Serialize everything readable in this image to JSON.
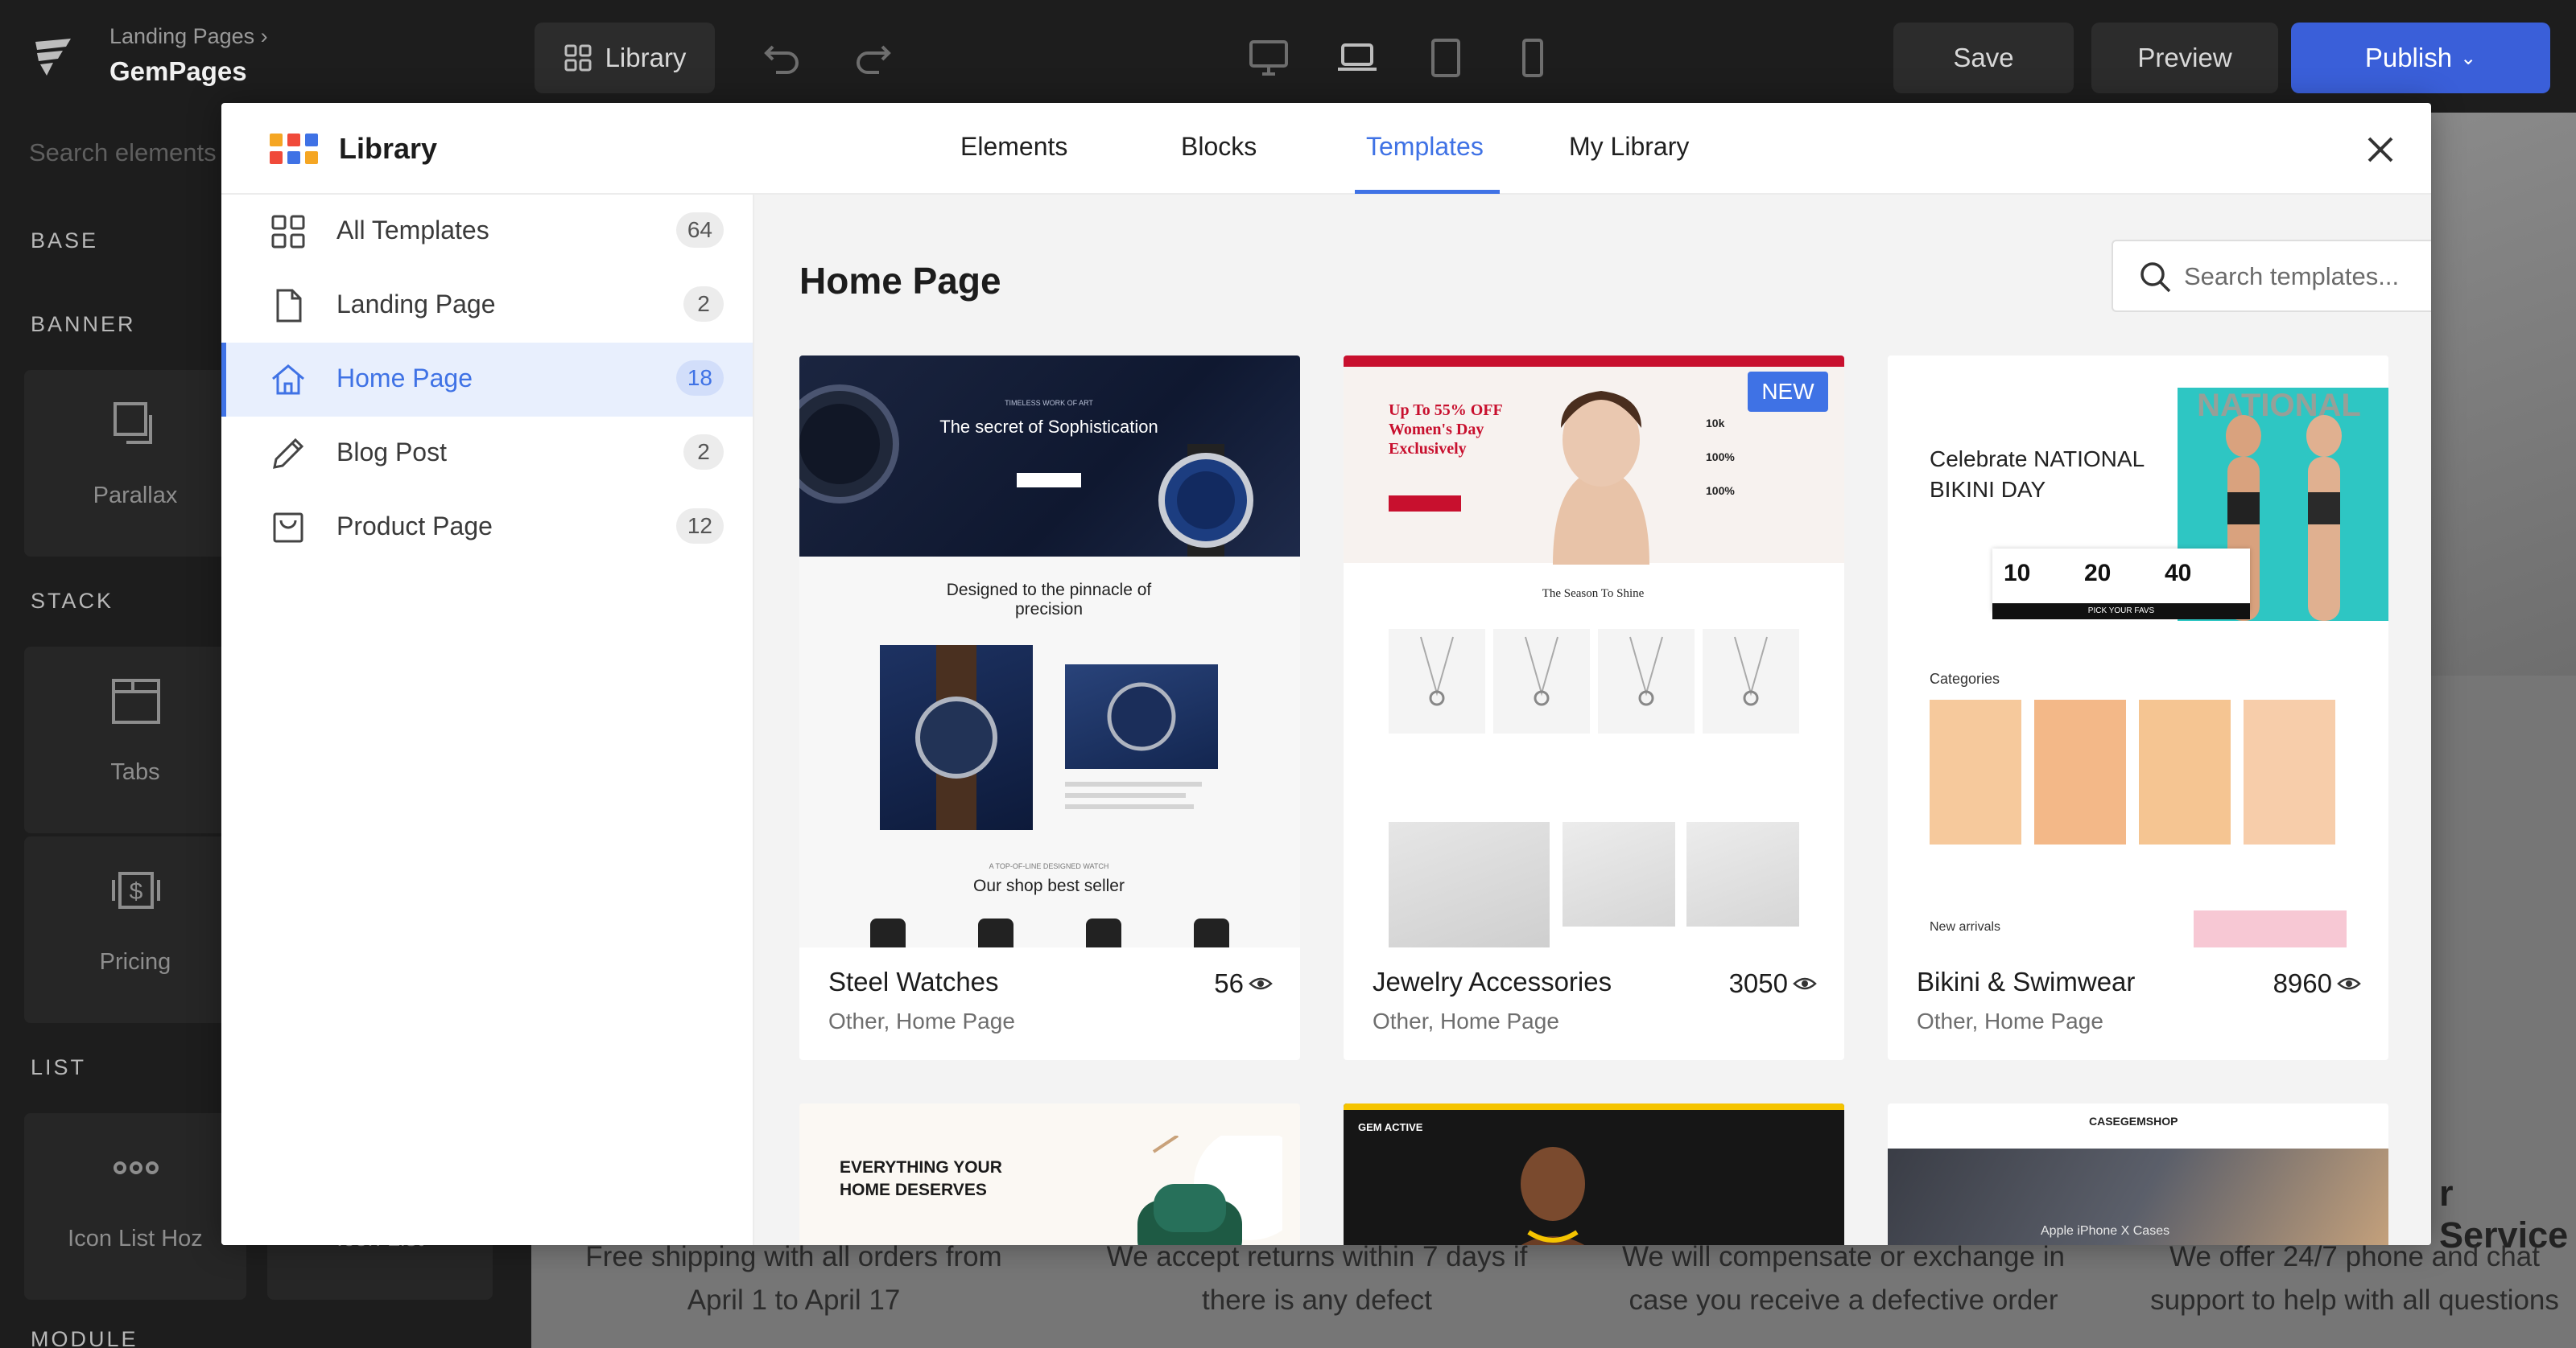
{
  "editor": {
    "breadcrumb": "Landing Pages",
    "app_name": "GemPages",
    "library_button": "Library",
    "save": "Save",
    "preview": "Preview",
    "publish": "Publish"
  },
  "left_panel": {
    "search_placeholder": "Search elements",
    "sections": [
      "BASE",
      "BANNER",
      "STACK",
      "LIST",
      "MODULE"
    ],
    "tiles": [
      {
        "label": "Parallax",
        "icon": "parallax-icon"
      },
      {
        "label": "Tabs",
        "icon": "tabs-icon"
      },
      {
        "label": "Pricing",
        "icon": "pricing-icon"
      },
      {
        "label": "Icon List Hoz",
        "icon": "icon-list-icon"
      },
      {
        "label": "Icon List",
        "icon": "icon-list-icon"
      }
    ]
  },
  "canvas": {
    "service_title": "r Service",
    "features": [
      "Free shipping with all orders from April 1 to April 17",
      "We accept returns within 7 days if there is any defect",
      "We will compensate or exchange in case you receive a defective order",
      "We offer 24/7 phone and chat support to help with all questions"
    ]
  },
  "modal": {
    "title": "Library",
    "tabs": [
      "Elements",
      "Blocks",
      "Templates",
      "My Library"
    ],
    "active_tab": "Templates",
    "categories": [
      {
        "label": "All Templates",
        "count": "64",
        "icon": "grid-icon"
      },
      {
        "label": "Landing Page",
        "count": "2",
        "icon": "document-icon"
      },
      {
        "label": "Home Page",
        "count": "18",
        "icon": "home-icon"
      },
      {
        "label": "Blog Post",
        "count": "2",
        "icon": "pencil-icon"
      },
      {
        "label": "Product Page",
        "count": "12",
        "icon": "bag-icon"
      }
    ],
    "section_title": "Home Page",
    "search_placeholder": "Search templates...",
    "templates": [
      {
        "name": "Steel Watches",
        "category": "Other, Home Page",
        "views": "56",
        "badge": "",
        "thumb": {
          "hero": "The secret of Sophistication",
          "eyebrow": "TIMELESS WORK OF ART",
          "mid": "Designed to the pinnacle of precision",
          "eyebrow2": "A TOP-OF-LINE DESIGNED WATCH",
          "bottom": "Our shop best seller"
        }
      },
      {
        "name": "Jewelry Accessories",
        "category": "Other, Home Page",
        "views": "3050",
        "badge": "NEW",
        "thumb": {
          "hero": "Up To 55% OFF Women's Day Exclusively",
          "stats": [
            "10k",
            "100%",
            "100%"
          ],
          "section": "The Season To Shine"
        }
      },
      {
        "name": "Bikini & Swimwear",
        "category": "Other, Home Page",
        "views": "8960",
        "badge": "",
        "thumb": {
          "hero": "Celebrate NATIONAL BIKINI DAY",
          "countdown": [
            "10",
            "20",
            "40"
          ],
          "cta": "PICK YOUR FAVS",
          "categories": "Categories",
          "new_arrivals": "New arrivals",
          "bg_word": "NATIONAL"
        }
      }
    ],
    "more_templates": [
      {
        "caption": "EVERYTHING YOUR HOME DESERVES"
      },
      {
        "caption": "GEM ACTIVE"
      },
      {
        "caption": "CASEGEMSHOP",
        "sub": "Apple iPhone X Cases"
      }
    ]
  },
  "colors": {
    "accent": "#3f72e5",
    "topbar": "#1d1d1d",
    "badge": "#3f72e5"
  }
}
